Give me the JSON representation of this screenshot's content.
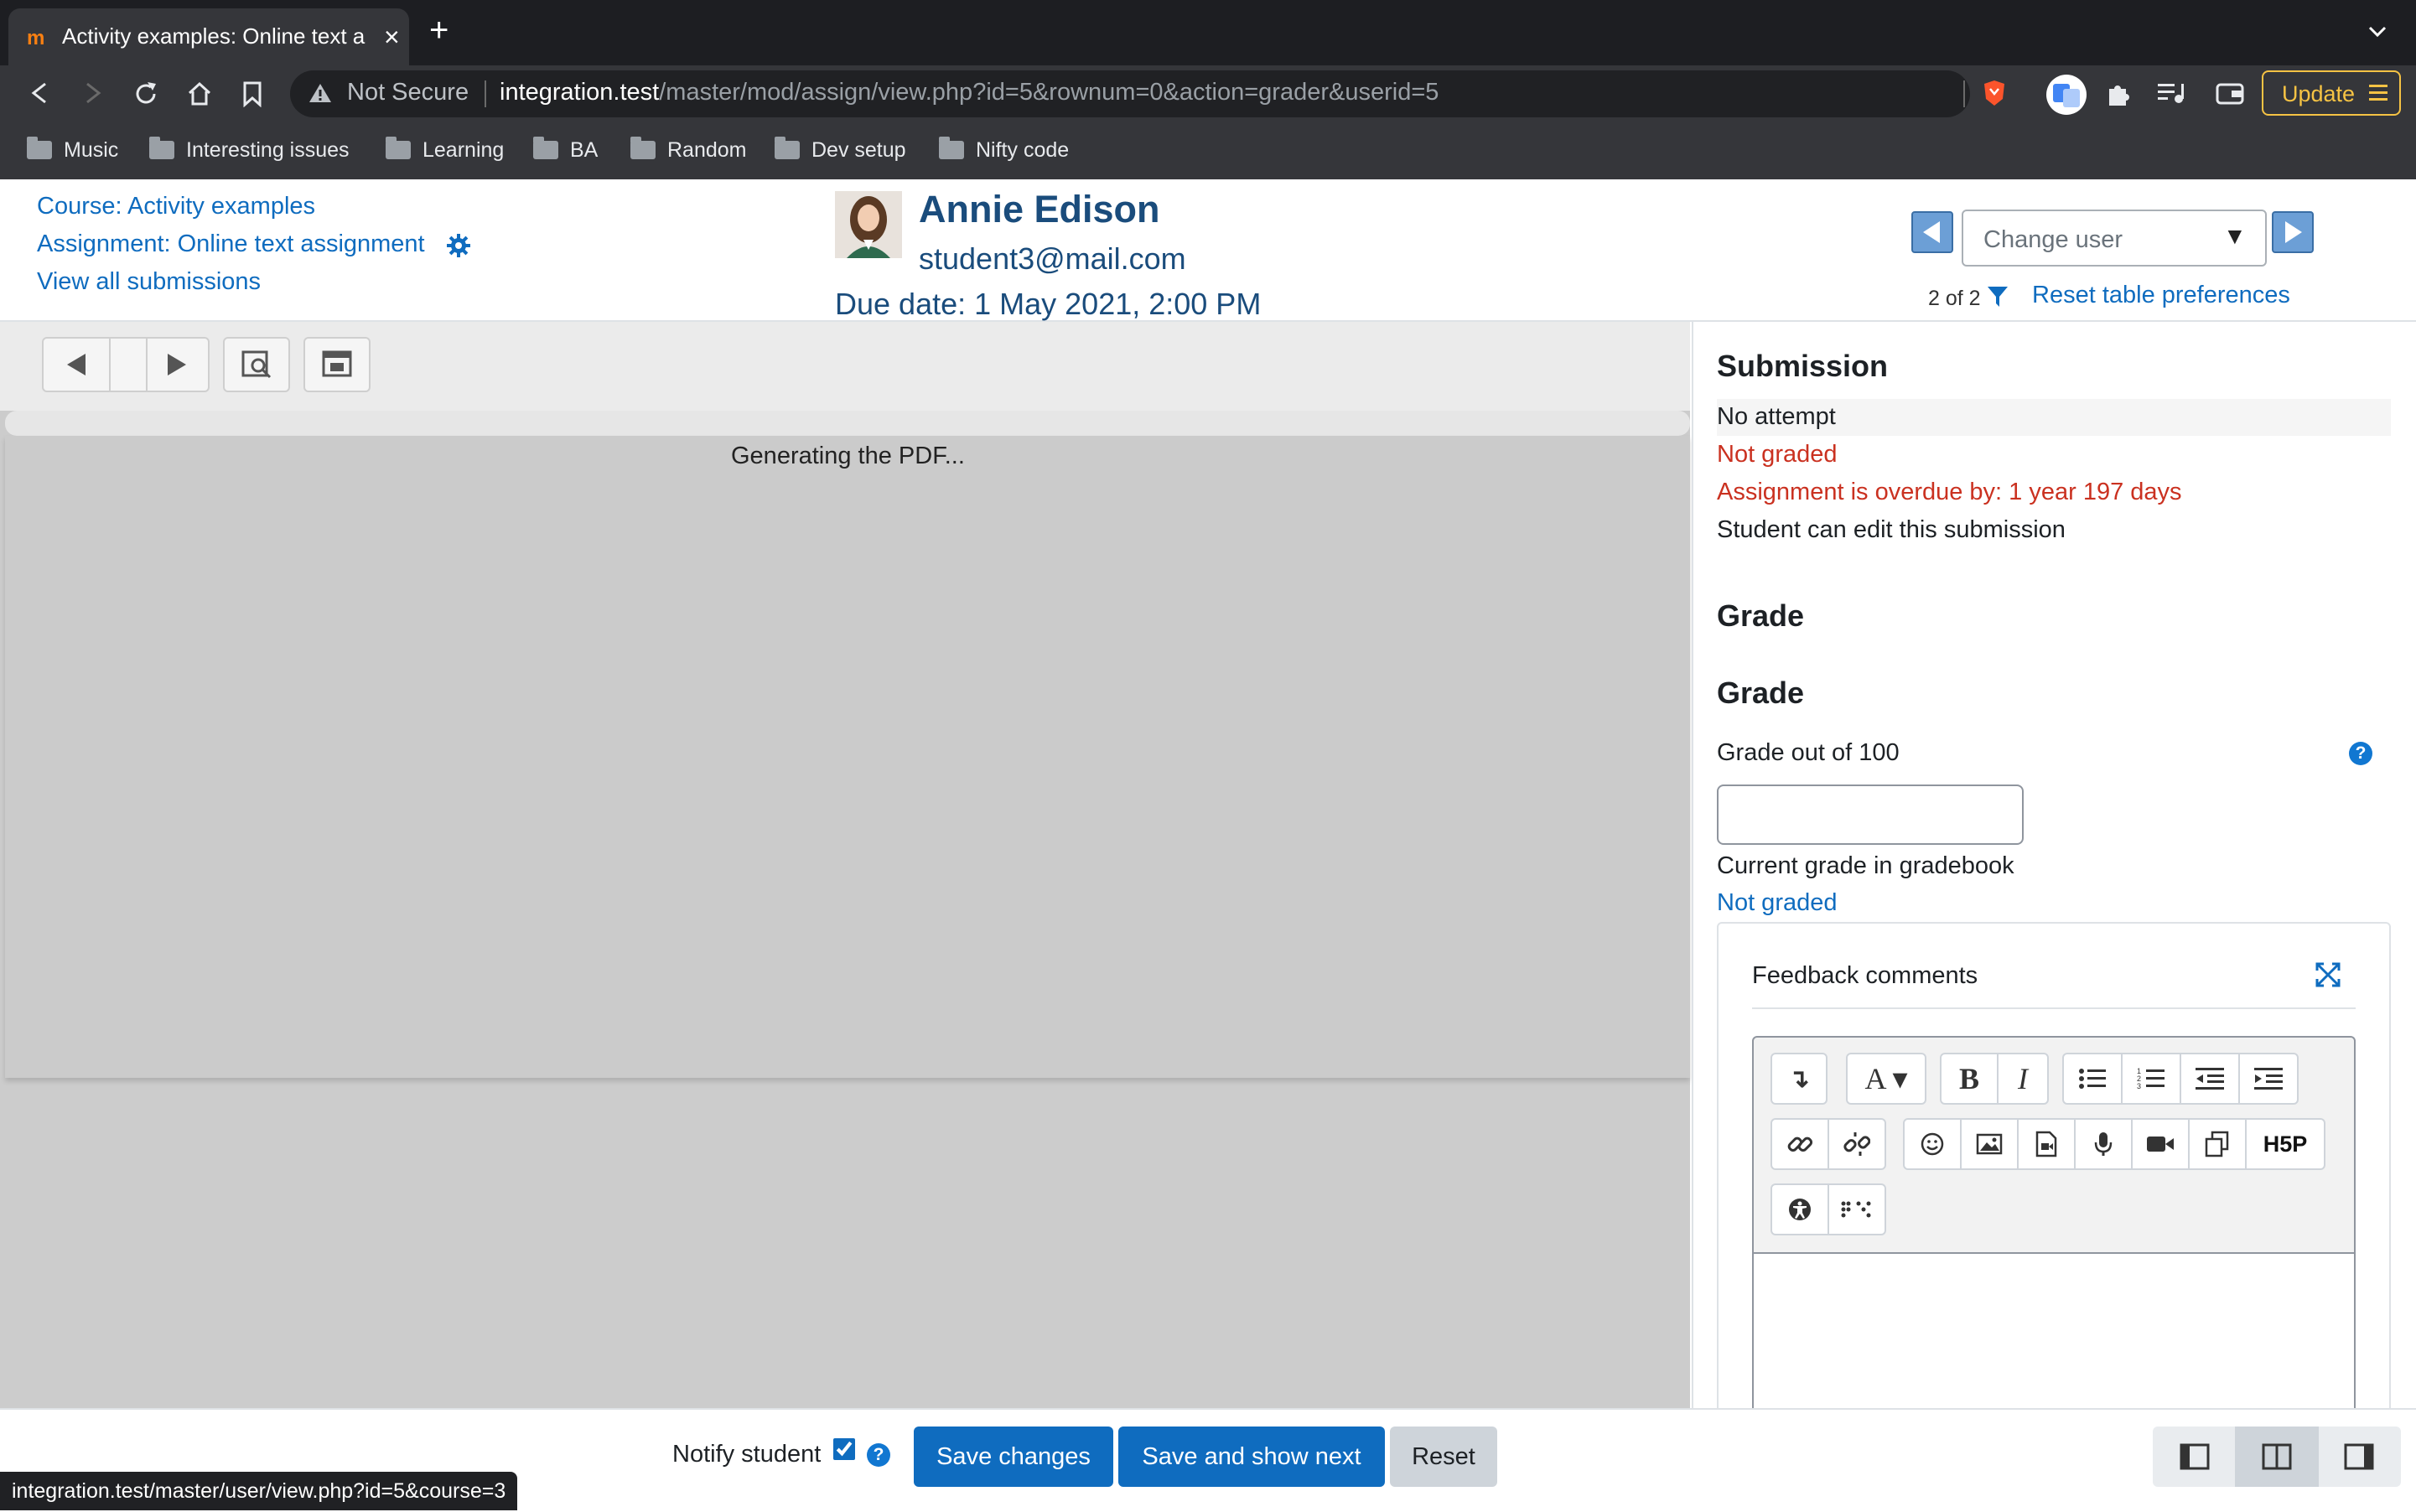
{
  "browser": {
    "tab_title": "Activity examples: Online text a",
    "tab_favicon": "m",
    "address": {
      "security_label": "Not Secure",
      "host": "integration.test",
      "path": "/master/mod/assign/view.php?id=5&rownum=0&action=grader&userid=5"
    },
    "update_label": "Update",
    "bookmarks": [
      "Music",
      "Interesting issues",
      "Learning",
      "BA",
      "Random",
      "Dev setup",
      "Nifty code"
    ]
  },
  "header": {
    "course_link": "Course: Activity examples",
    "assignment_link": "Assignment: Online text assignment",
    "view_all_link": "View all submissions",
    "user_name": "Annie Edison",
    "user_email": "student3@mail.com",
    "due_date": "Due date: 1 May 2021, 2:00 PM",
    "change_user_placeholder": "Change user",
    "pager_count": "2 of 2",
    "reset_prefs_link": "Reset table preferences"
  },
  "pdf": {
    "status": "Generating the PDF..."
  },
  "submission": {
    "heading": "Submission",
    "status": "No attempt",
    "grading_status": "Not graded",
    "overdue": "Assignment is overdue by: 1 year 197 days",
    "edit_status": "Student can edit this submission"
  },
  "grade": {
    "section_heading": "Grade",
    "heading": "Grade",
    "grade_label": "Grade out of 100",
    "grade_value": "",
    "gradebook_label": "Current grade in gradebook",
    "gradebook_value": "Not graded"
  },
  "feedback": {
    "heading": "Feedback comments",
    "h5p_label": "H5P"
  },
  "footer": {
    "notify_label": "Notify student",
    "notify_checked": true,
    "save_label": "Save changes",
    "save_next_label": "Save and show next",
    "reset_label": "Reset"
  },
  "status_bar_url": "integration.test/master/user/view.php?id=5&course=3",
  "colors": {
    "link": "#0f6cbf",
    "header_text": "#1a4c7c",
    "danger": "#ca3120",
    "primary_button": "#0f6cbf",
    "browser_dark": "#35363a",
    "update_accent": "#f6c344"
  }
}
